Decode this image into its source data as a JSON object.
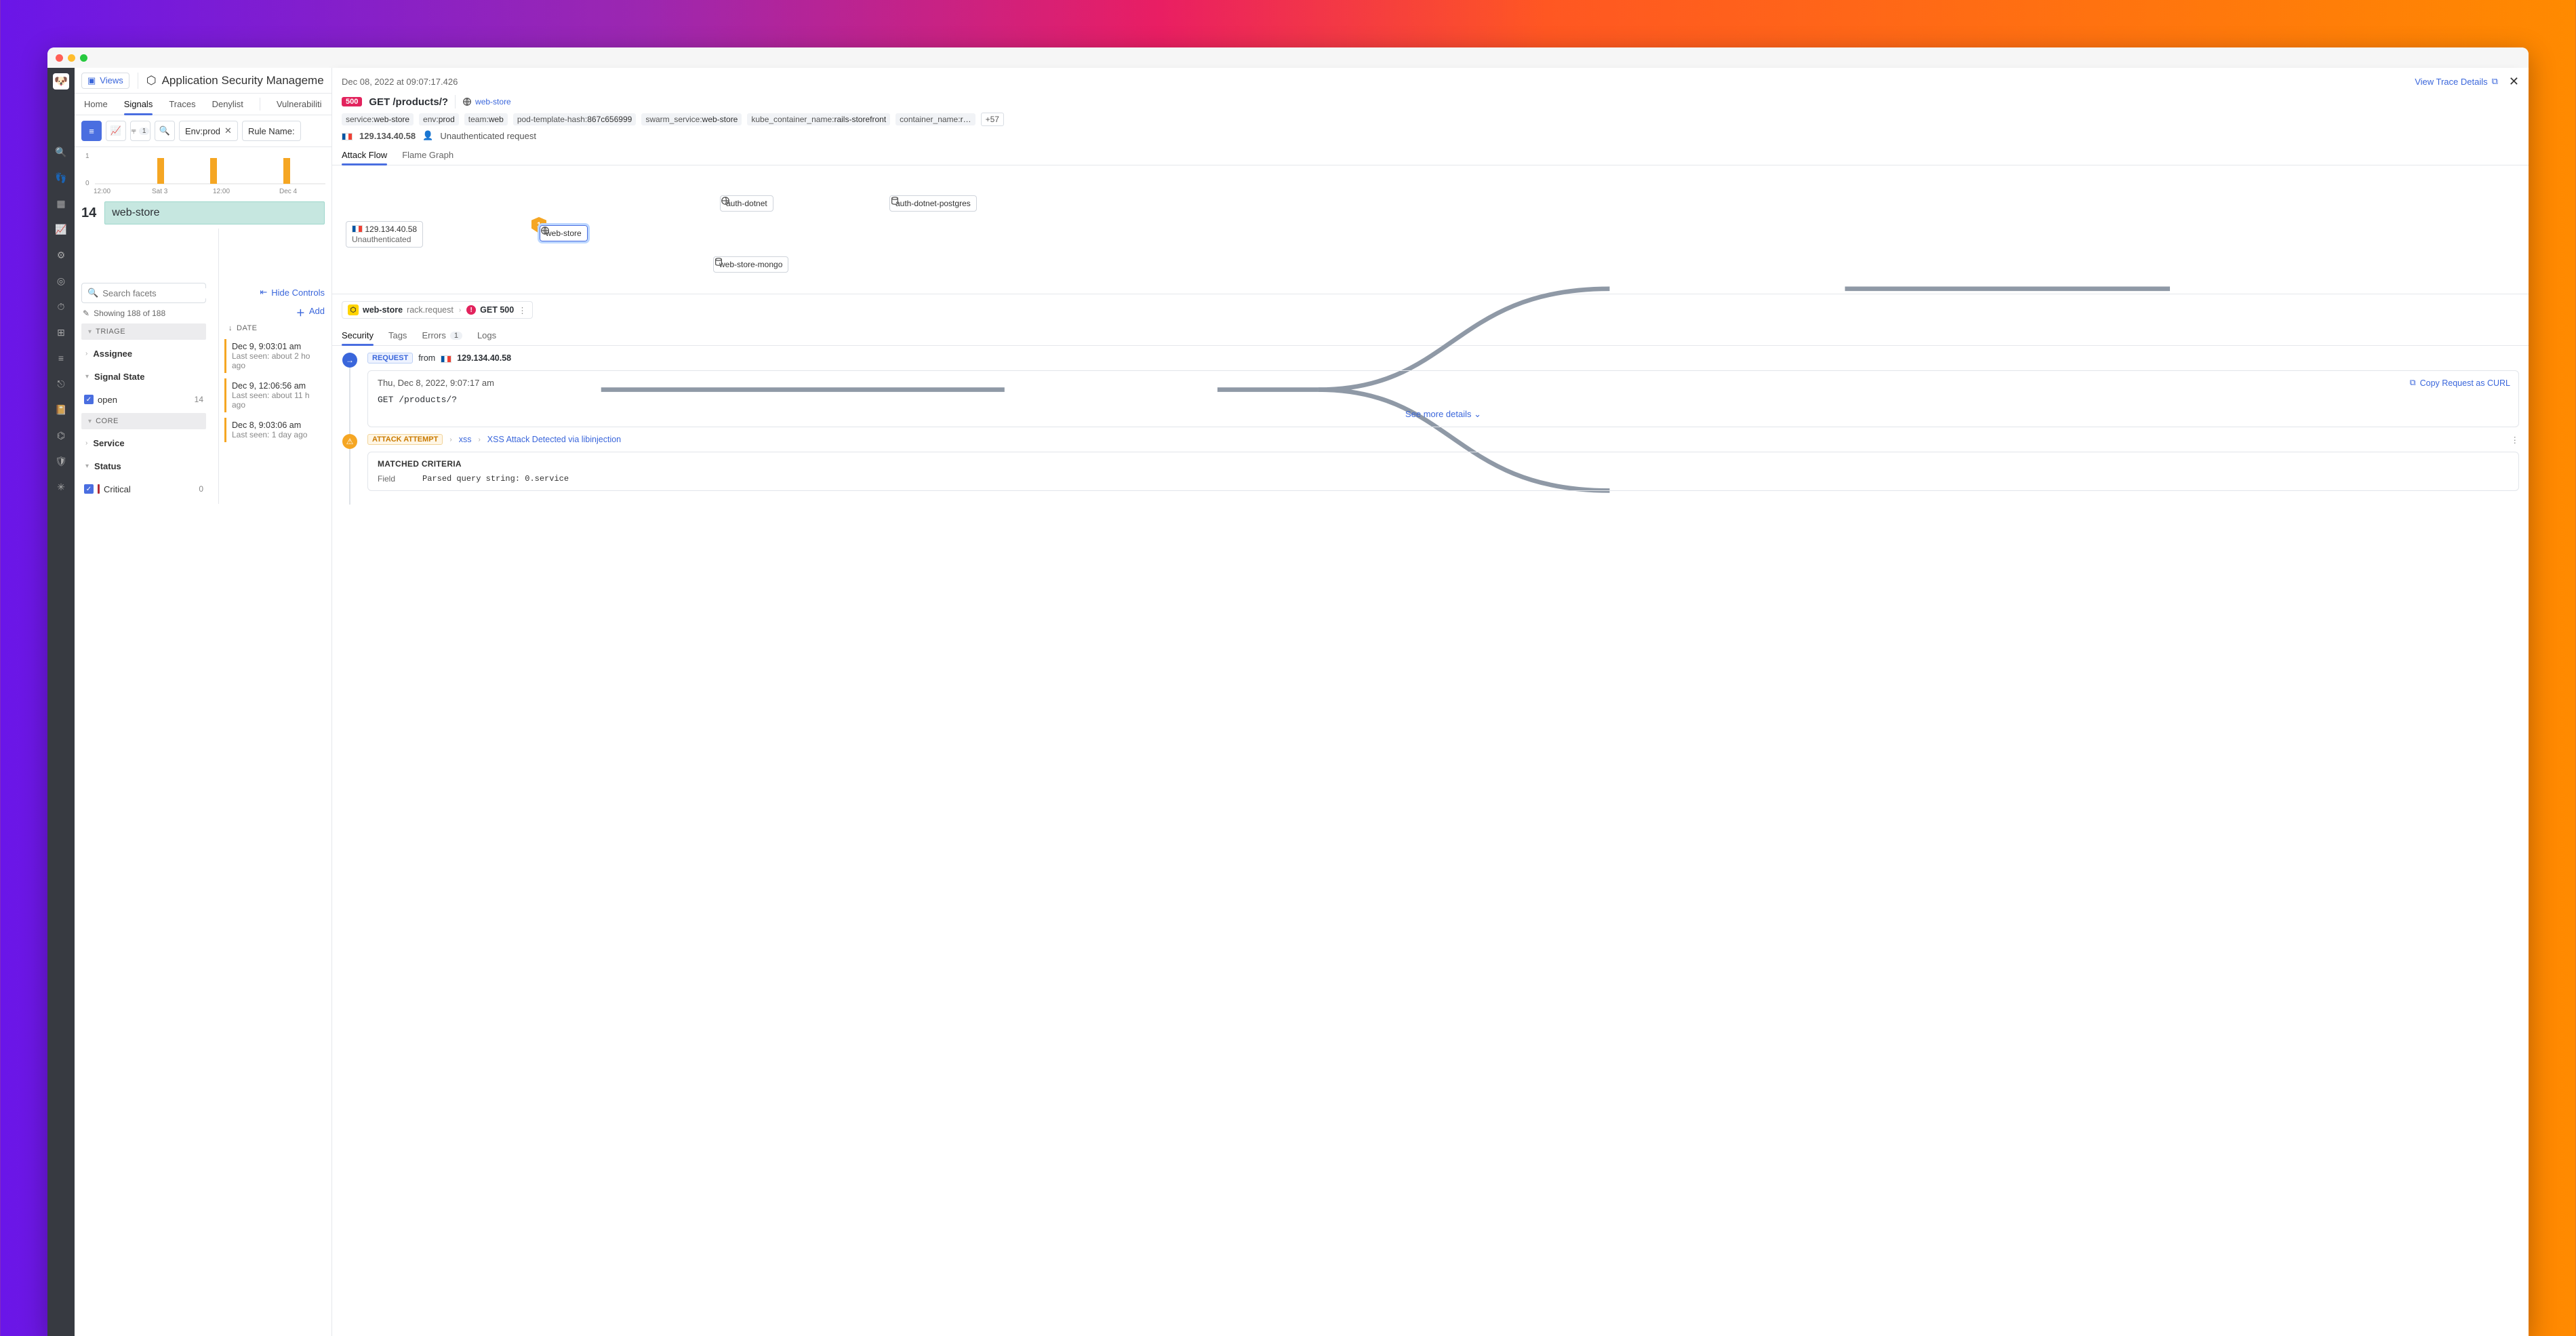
{
  "window": {
    "views_label": "Views",
    "page_title": "Application Security Manageme"
  },
  "nav_tabs": [
    "Home",
    "Signals",
    "Traces",
    "Denylist",
    "Vulnerabiliti"
  ],
  "nav_active": 1,
  "toolbar": {
    "filter_count": "1",
    "chip_env": "Env:prod",
    "chip_rule": "Rule Name:"
  },
  "chart_data": {
    "type": "bar",
    "y_ticks": [
      "1",
      "0"
    ],
    "x_ticks": [
      "12:00",
      "Sat 3",
      "12:00",
      "Dec 4"
    ],
    "series": [
      {
        "name": "signals",
        "values": [
          0,
          0,
          1,
          0,
          1,
          0,
          1,
          0
        ]
      }
    ],
    "color": "#f5a623"
  },
  "summary": {
    "count": "14",
    "label": "web-store"
  },
  "facets": {
    "search_placeholder": "Search facets",
    "hide_controls": "Hide Controls",
    "showing": "Showing 188 of 188",
    "add": "Add",
    "triage_head": "TRIAGE",
    "assignee": "Assignee",
    "signal_state": "Signal State",
    "open_label": "open",
    "open_count": "14",
    "core_head": "CORE",
    "service": "Service",
    "status": "Status",
    "critical_label": "Critical",
    "critical_count": "0"
  },
  "signals_list": {
    "date_head": "DATE",
    "rows": [
      {
        "time": "Dec 9, 9:03:01 am",
        "sub": "Last seen: about 2 ho",
        "sub2": "ago"
      },
      {
        "time": "Dec 9, 12:06:56 am",
        "sub": "Last seen: about 11 h",
        "sub2": "ago"
      },
      {
        "time": "Dec 8, 9:03:06 am",
        "sub": "Last seen: 1 day ago",
        "sub2": ""
      }
    ]
  },
  "detail": {
    "timestamp": "Dec 08, 2022 at 09:07:17.426",
    "view_trace": "View Trace Details",
    "status_badge": "500",
    "method": "GET",
    "path": "/products/?",
    "service": "web-store",
    "tags": [
      {
        "k": "service",
        "v": "web-store"
      },
      {
        "k": "env",
        "v": "prod"
      },
      {
        "k": "team",
        "v": "web"
      },
      {
        "k": "pod-template-hash",
        "v": "867c656999"
      },
      {
        "k": "swarm_service",
        "v": "web-store"
      },
      {
        "k": "kube_container_name",
        "v": "rails-storefront"
      },
      {
        "k": "container_name",
        "v": "r…"
      }
    ],
    "more_tags": "+57",
    "ip": "129.134.40.58",
    "auth": "Unauthenticated request",
    "flow_tabs": [
      "Attack Flow",
      "Flame Graph"
    ],
    "flow": {
      "src_ip": "129.134.40.58",
      "src_sub": "Unauthenticated",
      "center": "web-store",
      "shield": "1",
      "node_top": "auth-dotnet",
      "node_top_right": "auth-dotnet-postgres",
      "node_bottom": "web-store-mongo"
    },
    "breadcrumb": {
      "svc": "web-store",
      "op": "rack.request",
      "span": "GET 500"
    },
    "span_tabs": {
      "items": [
        "Security",
        "Tags",
        "Errors",
        "Logs"
      ],
      "errors_count": "1"
    },
    "request": {
      "label": "REQUEST",
      "from": "from",
      "ip": "129.134.40.58",
      "date": "Thu, Dec 8, 2022, 9:07:17 am",
      "line": "GET  /products/?",
      "copy": "Copy Request as CURL",
      "see_more": "See more details"
    },
    "attack": {
      "label": "ATTACK ATTEMPT",
      "type": "xss",
      "desc": "XSS Attack Detected via libinjection",
      "matched_head": "MATCHED CRITERIA",
      "field_label": "Field",
      "parsed": "Parsed query string: 0.service"
    }
  }
}
